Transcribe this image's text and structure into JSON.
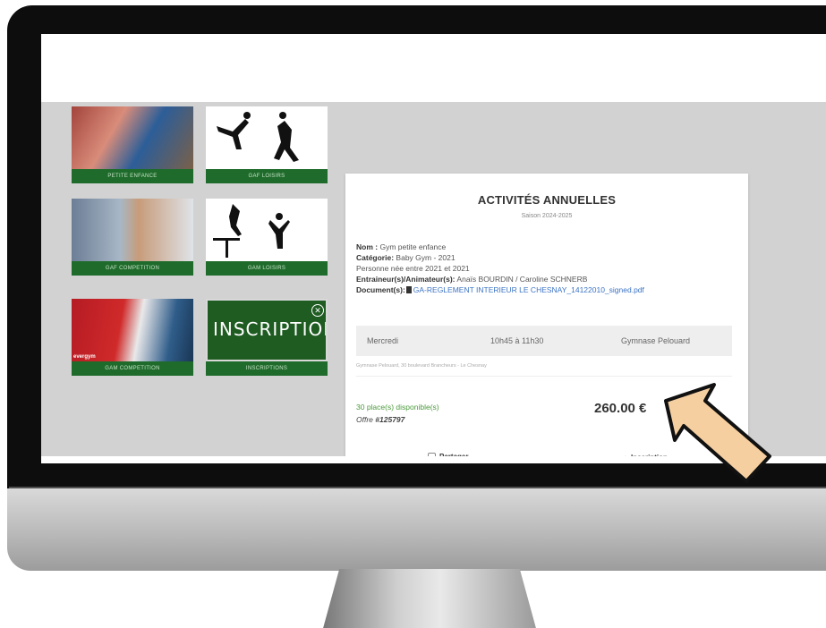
{
  "tiles": [
    {
      "label": "PETITE ENFANCE"
    },
    {
      "label": "GAF LOISIRS"
    },
    {
      "label": "GAF COMPETITION"
    },
    {
      "label": "GAM LOISIRS"
    },
    {
      "label": "GAM COMPETITION"
    },
    {
      "label": "INSCRIPTION",
      "bar_label": "INSCRIPTIONS"
    }
  ],
  "tile_photo_caption": "evergym",
  "card": {
    "title": "ACTIVITÉS ANNUELLES",
    "season": "Saison 2024-2025",
    "name_label": "Nom :",
    "name_value": "Gym petite enfance",
    "category_label": "Catégorie:",
    "category_value": "Baby Gym - 2021",
    "born_text": "Personne née entre 2021 et 2021",
    "coach_label": "Entraineur(s)/Animateur(s):",
    "coach_value": "Anaïs BOURDIN / Caroline SCHNERB",
    "doc_label": "Document(s):",
    "doc_value": "GA-REGLEMENT INTERIEUR LE CHESNAY_14122010_signed.pdf",
    "schedule": {
      "day": "Mercredi",
      "time": "10h45 à 11h30",
      "place": "Gymnase Pelouard"
    },
    "address": "Gymnase Pelouard, 30 boulevard Brancheurs - Le Chesnay",
    "places": "30 place(s) disponible(s)",
    "offer_label": "Offre",
    "offer_id": "#125797",
    "price": "260.00 €",
    "share_label": "Partager",
    "inscription_label": "Inscription"
  },
  "colors": {
    "tile_green": "#1e6b2b",
    "link_blue": "#3b73c4",
    "places_green": "#4b9a3b",
    "arrow_fill": "#f6cfa0"
  }
}
